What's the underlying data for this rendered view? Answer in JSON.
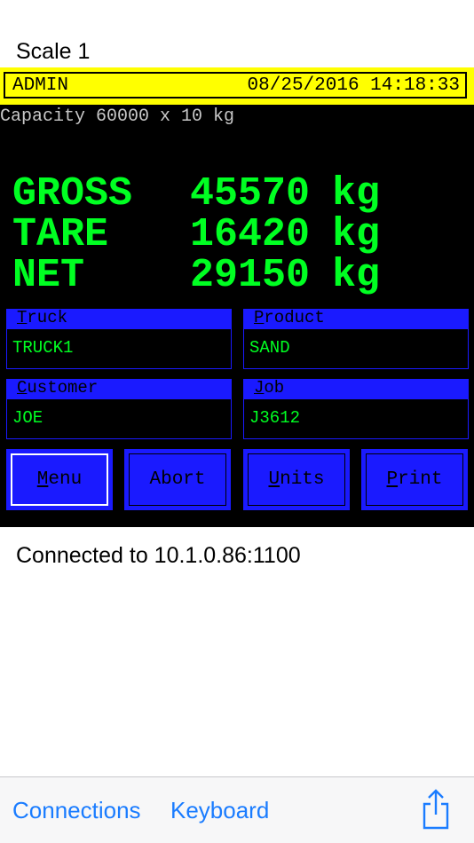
{
  "header": {
    "scale_title": "Scale 1"
  },
  "terminal": {
    "user": "ADMIN",
    "datetime": "08/25/2016 14:18:33",
    "capacity": "Capacity 60000 x 10 kg",
    "weights": [
      {
        "label": "GROSS",
        "value": "45570",
        "unit": "kg"
      },
      {
        "label": "TARE",
        "value": "16420",
        "unit": "kg"
      },
      {
        "label": "NET",
        "value": "29150",
        "unit": "kg"
      }
    ],
    "fields": {
      "truck": {
        "label_first": "T",
        "label_rest": "ruck",
        "value": "TRUCK1"
      },
      "product": {
        "label_first": "P",
        "label_rest": "roduct",
        "value": "SAND"
      },
      "customer": {
        "label_first": "C",
        "label_rest": "ustomer",
        "value": "JOE"
      },
      "job": {
        "label_first": "J",
        "label_rest": "ob",
        "value": "J3612"
      }
    },
    "buttons": {
      "menu": {
        "first": "M",
        "rest": "enu"
      },
      "abort": {
        "label": "Abort"
      },
      "units": {
        "first": "U",
        "rest": "nits"
      },
      "print": {
        "first": "P",
        "rest": "rint"
      }
    }
  },
  "status": {
    "text": "Connected to 10.1.0.86:1100"
  },
  "toolbar": {
    "connections": "Connections",
    "keyboard": "Keyboard",
    "share_icon": "share-icon"
  },
  "colors": {
    "terminal_bg": "#000000",
    "header_bar": "#ffff00",
    "weight_text": "#00ff22",
    "field_blue": "#1a1aff",
    "link_blue": "#1a7cff"
  }
}
